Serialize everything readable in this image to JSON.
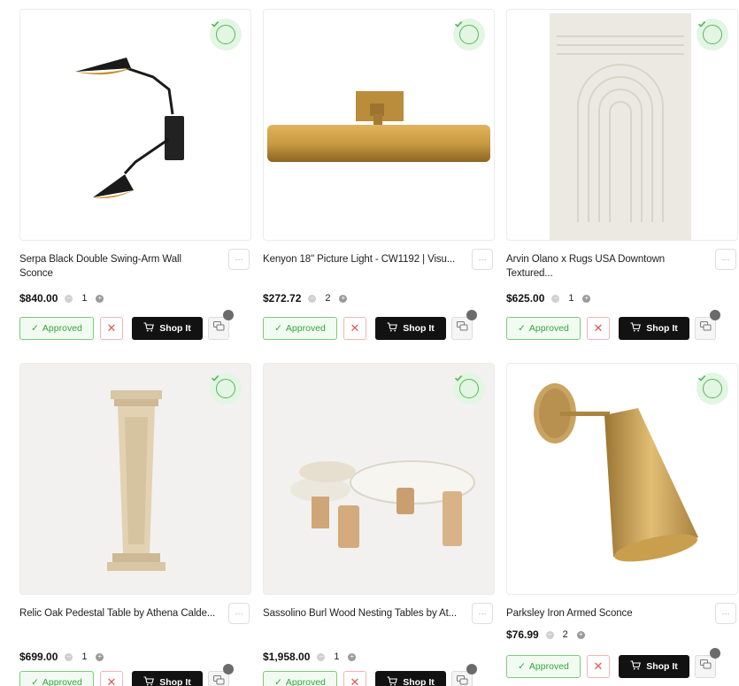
{
  "colors": {
    "approved_green": "#3aa33f",
    "reject_red": "#e05656",
    "shop_black": "#121212",
    "badge_green_bg": "#e3f5e3"
  },
  "icons": {
    "approved_status": "check-circle-icon",
    "more": "ellipsis-icon",
    "approve": "check-icon",
    "reject": "close-icon",
    "shop": "cart-icon",
    "comment": "chat-bubbles-icon"
  },
  "labels": {
    "approved": "Approved",
    "reject": "✕",
    "shop": "Shop It",
    "more": "···",
    "minus": "–",
    "plus": "+"
  },
  "products": [
    {
      "title": "Serpa Black Double Swing-Arm Wall Sconce",
      "price": "$840.00",
      "qty": "1",
      "image": "black double swing-arm wall sconce"
    },
    {
      "title": "Kenyon 18\" Picture Light - CW1192 | Visu...",
      "price": "$272.72",
      "qty": "2",
      "image": "brass picture light"
    },
    {
      "title": "Arvin Olano x Rugs USA Downtown Textured...",
      "price": "$625.00",
      "qty": "1",
      "image": "ivory textured rug"
    },
    {
      "title": "Relic Oak Pedestal Table by Athena Calde...",
      "price": "$699.00",
      "qty": "1",
      "image": "travertine pedestal table"
    },
    {
      "title": "Sassolino Burl Wood Nesting Tables by At...",
      "price": "$1,958.00",
      "qty": "1",
      "image": "burl wood nesting tables"
    },
    {
      "title": "Parksley Iron Armed Sconce",
      "price": "$76.99",
      "qty": "2",
      "image": "brass armed sconce"
    }
  ]
}
